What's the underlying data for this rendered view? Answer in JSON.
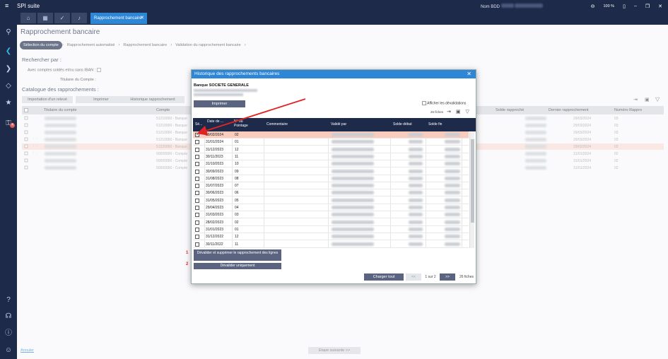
{
  "app": {
    "title": "SPI suite",
    "nom_bdd_label": "Nom BDD",
    "zoom": "100 %"
  },
  "tabs": {
    "main_label": "Rapprochement bancaire"
  },
  "page": {
    "title": "Rapprochement bancaire"
  },
  "breadcrumb": [
    "Sélection du compte",
    "Rapprochement automatisé",
    "Rapprochement bancaire",
    "Validation du rapprochement bancaire"
  ],
  "search": {
    "title": "Rechercher par :",
    "with_balance_label": "Avec comptes soldés et/ou sans IBAN :",
    "holder_label": "Titulaire du Compte :"
  },
  "catalog": {
    "title": "Catalogue des rapprochements :",
    "buttons": [
      "Importation d'un relevé",
      "Imprimer",
      "Historique rapprochement"
    ],
    "headers": [
      "Titulaire du compte",
      "Compte",
      "Solde rapproché",
      "Dernier rapprochement",
      "Numéro Rappro"
    ],
    "rows": [
      {
        "compte": "51210000 - Banque",
        "date": "29/03/2024",
        "num": "03"
      },
      {
        "compte": "51210000 - Banque",
        "date": "29/03/2024",
        "num": "03"
      },
      {
        "compte": "51210000 - Banque",
        "date": "29/03/2024",
        "num": "03"
      },
      {
        "compte": "51210000 - Banque",
        "date": "29/03/2024",
        "num": "03"
      },
      {
        "compte": "51220000 - Banque",
        "date": "29/02/2024",
        "num": "02"
      },
      {
        "compte": "50000000 - Compte",
        "date": "31/01/2024",
        "num": "02"
      },
      {
        "compte": "50000000 - Compte",
        "date": "31/01/2024",
        "num": "02"
      },
      {
        "compte": "50000000 - Compte",
        "date": "31/01/2024",
        "num": "02"
      }
    ]
  },
  "footer": {
    "cancel": "Annuler",
    "next": "Etape suivante >>"
  },
  "modal": {
    "title": "Historique des rapprochements bancaires",
    "bank": "Banque SOCIETE GENERALE",
    "print": "Imprimer",
    "show_devalidations": "Afficher les dévalidations",
    "count_top": "26 fiches",
    "headers": {
      "sel": "Sé...",
      "date": "Date de ...",
      "num": "N° ou Pointage",
      "comment": "Commentaire",
      "validated_by": "Validé par",
      "solde_debut": "Solde début",
      "solde_fin": "Solde fin"
    },
    "rows": [
      {
        "date": "29/02/2024",
        "num": "02",
        "selected": true
      },
      {
        "date": "31/01/2024",
        "num": "01"
      },
      {
        "date": "31/12/2023",
        "num": "12"
      },
      {
        "date": "30/11/2023",
        "num": "11"
      },
      {
        "date": "31/10/2023",
        "num": "10"
      },
      {
        "date": "30/09/2023",
        "num": "09"
      },
      {
        "date": "31/08/2023",
        "num": "08"
      },
      {
        "date": "31/07/2023",
        "num": "07"
      },
      {
        "date": "30/06/2023",
        "num": "06"
      },
      {
        "date": "31/05/2023",
        "num": "05"
      },
      {
        "date": "29/04/2023",
        "num": "04"
      },
      {
        "date": "31/03/2023",
        "num": "03"
      },
      {
        "date": "28/02/2023",
        "num": "02"
      },
      {
        "date": "31/01/2023",
        "num": "01"
      },
      {
        "date": "31/12/2022",
        "num": "12"
      },
      {
        "date": "30/11/2022",
        "num": "11"
      }
    ],
    "action1": "Dévalider et supprimer le rapprochement des lignes",
    "action2": "Dévalider uniquement",
    "mark1": "1",
    "mark2": "2",
    "load_all": "Charger tout",
    "prev": "<<",
    "page": "1 sur 2",
    "next": ">>",
    "count_bottom": "26 fiches"
  },
  "colors": {
    "navy": "#1d2a4a",
    "accent": "#2e86d6",
    "highlight": "#f9ccbd",
    "annotation": "#e02424"
  }
}
